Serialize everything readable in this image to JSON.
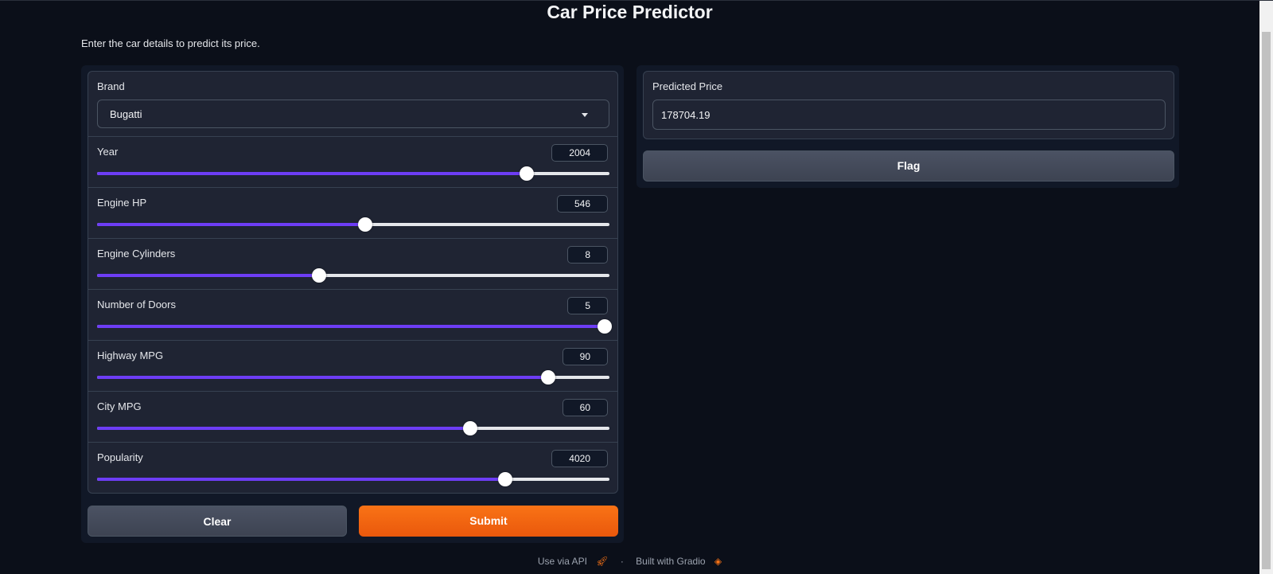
{
  "header": {
    "title": "Car Price Predictor",
    "description": "Enter the car details to predict its price."
  },
  "inputs": {
    "brand": {
      "label": "Brand",
      "selected": "Bugatti"
    },
    "sliders": [
      {
        "key": "year",
        "label": "Year",
        "value": "2004",
        "fraction": 0.838
      },
      {
        "key": "engine_hp",
        "label": "Engine HP",
        "value": "546",
        "fraction": 0.524
      },
      {
        "key": "engine_cylinders",
        "label": "Engine Cylinders",
        "value": "8",
        "fraction": 0.433
      },
      {
        "key": "doors",
        "label": "Number of Doors",
        "value": "5",
        "fraction": 0.99
      },
      {
        "key": "highway_mpg",
        "label": "Highway MPG",
        "value": "90",
        "fraction": 0.88
      },
      {
        "key": "city_mpg",
        "label": "City MPG",
        "value": "60",
        "fraction": 0.729
      },
      {
        "key": "popularity",
        "label": "Popularity",
        "value": "4020",
        "fraction": 0.797
      }
    ]
  },
  "actions": {
    "clear_label": "Clear",
    "submit_label": "Submit",
    "flag_label": "Flag"
  },
  "output": {
    "label": "Predicted Price",
    "value": "178704.19"
  },
  "footer": {
    "api_label": "Use via API",
    "separator": "·",
    "built_label": "Built with Gradio"
  },
  "colors": {
    "background": "#0b0f19",
    "slider_fill": "#6d3df5",
    "submit": "#f97316"
  },
  "icons": {
    "api": "rocket-icon",
    "gradio": "gradio-logo-icon",
    "dropdown": "chevron-down-icon"
  }
}
